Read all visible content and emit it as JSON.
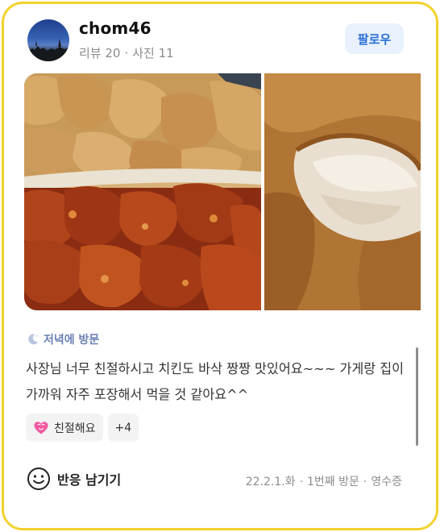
{
  "user": {
    "name": "chom46",
    "review_count_label": "리뷰 20",
    "photo_count_label": "사진 11",
    "separator": "·",
    "follow_label": "팔로우"
  },
  "photos": [
    {
      "description_icon": "food-photo"
    },
    {
      "description_icon": "food-photo"
    }
  ],
  "visit": {
    "icon": "moon-icon",
    "label": "저녁에 방문"
  },
  "review": {
    "text": "사장님 너무 친절하시고 치킨도 바삭 짱짱 맛있어요~~~ 가게랑 집이 가까워 자주 포장해서 먹을 것 같아요^^"
  },
  "tags": {
    "primary": {
      "icon": "heart-icon",
      "label": "친절해요"
    },
    "more_label": "+4"
  },
  "reaction": {
    "icon": "smile-icon",
    "label": "반응 남기기"
  },
  "footer": {
    "date": "22.2.1.화",
    "visit_count": "1번째 방문",
    "verification": "영수증",
    "separator": "·"
  },
  "colors": {
    "card_border": "#f4d22e",
    "follow_bg": "#e8f1fc",
    "follow_text": "#2a6fd6",
    "visit_text": "#6a7fb3"
  }
}
